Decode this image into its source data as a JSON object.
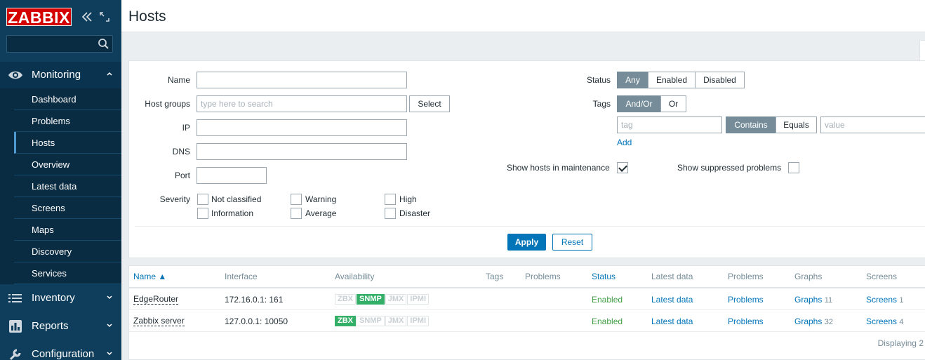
{
  "sidebar": {
    "logo": "ZABBIX",
    "search": {
      "value": "",
      "placeholder": ""
    },
    "sections": {
      "monitoring": "Monitoring",
      "inventory": "Inventory",
      "reports": "Reports",
      "configuration": "Configuration"
    },
    "monitoring_items": [
      "Dashboard",
      "Problems",
      "Hosts",
      "Overview",
      "Latest data",
      "Screens",
      "Maps",
      "Discovery",
      "Services"
    ],
    "active_item": "Hosts"
  },
  "page": {
    "title": "Hosts"
  },
  "filter": {
    "name_label": "Name",
    "name_value": "",
    "host_groups_label": "Host groups",
    "host_groups_placeholder": "type here to search",
    "select_label": "Select",
    "ip_label": "IP",
    "ip_value": "",
    "dns_label": "DNS",
    "dns_value": "",
    "port_label": "Port",
    "port_value": "",
    "severity_label": "Severity",
    "severities": [
      "Not classified",
      "Information",
      "Warning",
      "Average",
      "High",
      "Disaster"
    ],
    "status_label": "Status",
    "status_options": [
      "Any",
      "Enabled",
      "Disabled"
    ],
    "status_selected": "Any",
    "tags_label": "Tags",
    "tags_options": [
      "And/Or",
      "Or"
    ],
    "tags_selected": "And/Or",
    "tag_placeholder": "tag",
    "tag_ops": [
      "Contains",
      "Equals"
    ],
    "tag_op_selected": "Contains",
    "value_placeholder": "value",
    "add_label": "Add",
    "maintenance_label": "Show hosts in maintenance",
    "maintenance_checked": true,
    "suppressed_label": "Show suppressed problems",
    "suppressed_checked": false,
    "apply_label": "Apply",
    "reset_label": "Reset"
  },
  "table": {
    "columns": {
      "name": "Name ▲",
      "interface": "Interface",
      "availability": "Availability",
      "tags": "Tags",
      "problems": "Problems",
      "status": "Status",
      "latest": "Latest data",
      "problems2": "Problems",
      "graphs": "Graphs",
      "screens": "Screens"
    },
    "rows": [
      {
        "name": "EdgeRouter",
        "interface": "172.16.0.1: 161",
        "availability": [
          "ZBX",
          "SNMP",
          "JMX",
          "IPMI"
        ],
        "available_active": "SNMP",
        "status": "Enabled",
        "latest": "Latest data",
        "problems": "Problems",
        "graphs": "Graphs",
        "graphs_count": "11",
        "screens": "Screens",
        "screens_count": "1"
      },
      {
        "name": "Zabbix server",
        "interface": "127.0.0.1: 10050",
        "availability": [
          "ZBX",
          "SNMP",
          "JMX",
          "IPMI"
        ],
        "available_active": "ZBX",
        "status": "Enabled",
        "latest": "Latest data",
        "problems": "Problems",
        "graphs": "Graphs",
        "graphs_count": "32",
        "screens": "Screens",
        "screens_count": "4"
      }
    ],
    "footer": "Displaying 2"
  },
  "colors": {
    "sidebar": "#0e3e5c",
    "logo_red": "#d40000",
    "accent_blue": "#0275b8",
    "enabled_green": "#429e47",
    "availability_green": "#34af67"
  }
}
